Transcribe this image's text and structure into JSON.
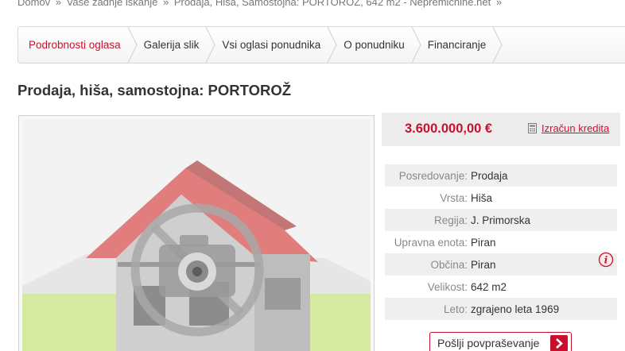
{
  "breadcrumb": {
    "home": "Domov",
    "last_search": "Vaše zadnje iskanje",
    "current": "Prodaja, Hiša, Samostojna: PORTOROŽ, 642 m2 - Nepremicnine.net",
    "separator": "»"
  },
  "tabs": [
    {
      "label": "Podrobnosti oglasa",
      "active": true
    },
    {
      "label": "Galerija slik"
    },
    {
      "label": "Vsi oglasi ponudnika"
    },
    {
      "label": "O ponudniku"
    },
    {
      "label": "Financiranje"
    }
  ],
  "listing": {
    "title": "Prodaja, hiša, samostojna: PORTOROŽ",
    "price": "3.600.000,00 €",
    "calc_link": "Izračun kredita",
    "details": [
      {
        "label": "Posredovanje:",
        "value": "Prodaja"
      },
      {
        "label": "Vrsta:",
        "value": "Hiša"
      },
      {
        "label": "Regija:",
        "value": "J. Primorska"
      },
      {
        "label": "Upravna enota:",
        "value": "Piran"
      },
      {
        "label": "Občina:",
        "value": "Piran"
      },
      {
        "label": "Velikost:",
        "value": "642 m2"
      },
      {
        "label": "Leto:",
        "value": "zgrajeno leta 1969"
      }
    ],
    "send_button": "Pošlji povpraševanje"
  },
  "icons": {
    "photo": "no-photo-placeholder-icon",
    "calculator": "calculator-icon",
    "info": "info-icon",
    "arrow": "chevron-right-icon"
  },
  "colors": {
    "accent": "#c8102e",
    "placeholder_grass": "#d5e9a0",
    "placeholder_roof": "#e07070"
  }
}
